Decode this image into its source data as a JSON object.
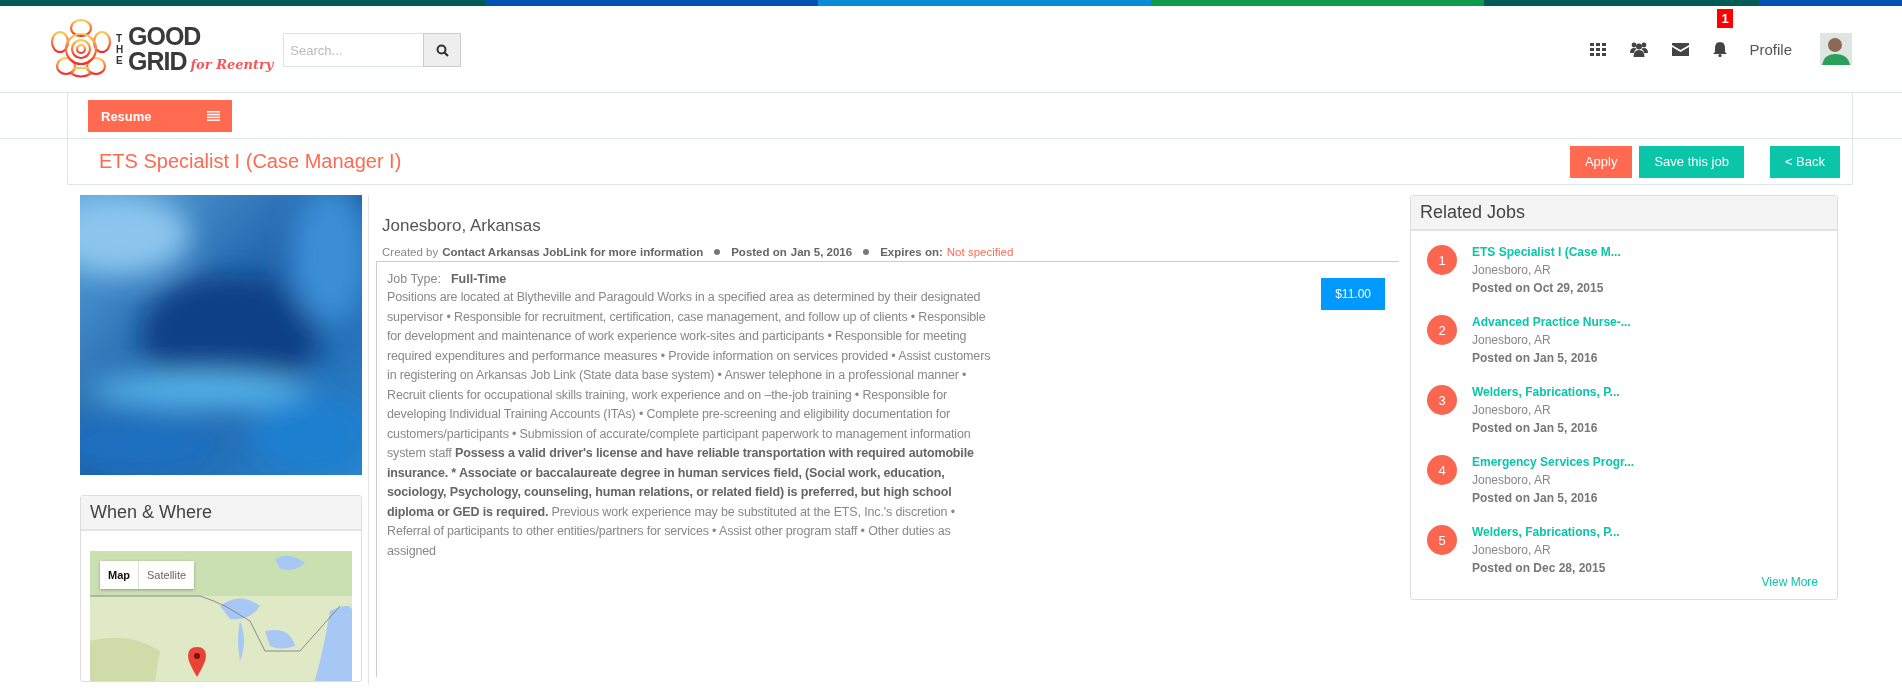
{
  "header": {
    "logo": {
      "the": "THE",
      "good": "GOOD",
      "grid": "GRID",
      "tagline": "for Reentry"
    },
    "search": {
      "placeholder": "Search..."
    },
    "notifications": {
      "count": "1"
    },
    "profile_label": "Profile"
  },
  "toolbar": {
    "resume_button": "Resume"
  },
  "job": {
    "title": "ETS Specialist I (Case Manager I)",
    "actions": [
      {
        "label": "Apply",
        "kind": "primary"
      },
      {
        "label": "Save this job",
        "kind": "secondary"
      },
      {
        "label": "< Back",
        "kind": "secondary"
      }
    ]
  },
  "when_where": {
    "title": "When & Where",
    "map_types": [
      {
        "label": "Map",
        "selected": true
      },
      {
        "label": "Satellite",
        "selected": false
      }
    ]
  },
  "details": {
    "location": "Jonesboro, Arkansas",
    "created_by_label": "Created by",
    "created_by": "Contact Arkansas JobLink for more information",
    "posted_label": "Posted on",
    "posted_date": "Jan 5, 2016",
    "expires_label": "Expires on:",
    "expires_value": "Not specified",
    "job_type_label": "Job Type:",
    "job_type": "Full-Time",
    "salary": "$11.00",
    "description": "Positions are located at Blytheville and Paragould Works in a specified area as determined by their designated supervisor • Responsible for recruitment, certification, case management, and follow up of clients • Responsible for development and maintenance of work experience work-sites and participants • Responsible for meeting required expenditures and performance measures • Provide information on services provided • Assist customers in registering on Arkansas Job Link (State data base system) • Answer telephone in a professional manner • Recruit clients for occupational skills training, work experience and on –the-job training • Responsible for developing Individual Training Accounts (ITAs) • Complete pre-screening and eligibility documentation for customers/participants • Submission of accurate/complete participant paperwork to management information system staff **Possess a valid driver's license and have reliable transportation with required automobile insurance. * Associate or baccalaureate degree in human services field, (Social work, education, sociology, Psychology, counseling, human relations, or related field) is preferred, but high school diploma or GED is required.** Previous work experience may be substituted at the ETS, Inc.'s discretion • Referral of participants to other entities/partners for services • Assist other program staff • Other duties as assigned"
  },
  "related_jobs": {
    "title": "Related Jobs",
    "items": [
      {
        "number": "1",
        "title": "ETS Specialist I (Case M...",
        "location": "Jonesboro, AR",
        "posted": "Posted on Oct 29, 2015"
      },
      {
        "number": "2",
        "title": "Advanced Practice Nurse-...",
        "location": "Jonesboro, AR",
        "posted": "Posted on Jan 5, 2016"
      },
      {
        "number": "3",
        "title": "Welders, Fabrications, P...",
        "location": "Jonesboro, AR",
        "posted": "Posted on Jan 5, 2016"
      },
      {
        "number": "4",
        "title": "Emergency Services Progr...",
        "location": "Jonesboro, AR",
        "posted": "Posted on Jan 5, 2016"
      },
      {
        "number": "5",
        "title": "Welders, Fabrications, P...",
        "location": "Jonesboro, AR",
        "posted": "Posted on Dec 28, 2015"
      }
    ],
    "view_more": "View More"
  }
}
